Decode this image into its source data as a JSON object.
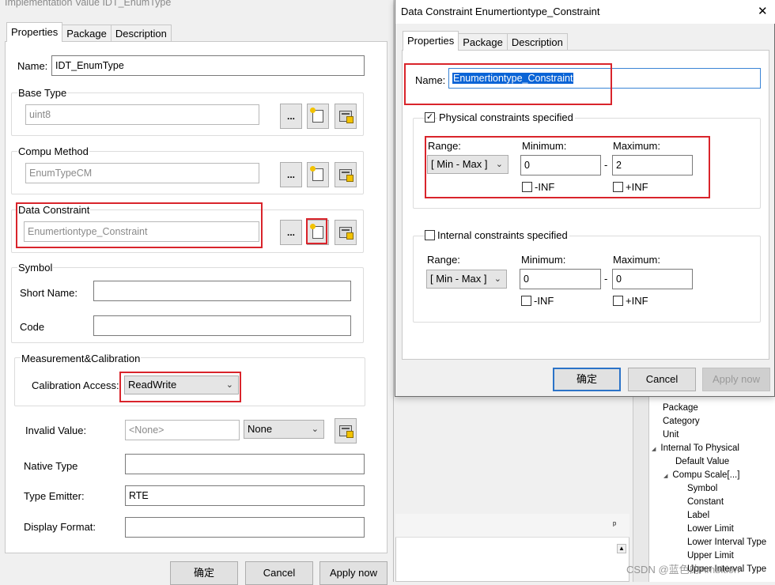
{
  "left_dialog": {
    "title": "Implementation Value IDT_EnumType",
    "tabs": [
      "Properties",
      "Package",
      "Description"
    ],
    "name_label": "Name:",
    "name_value": "IDT_EnumType",
    "base_type": {
      "label": "Base Type",
      "value": "uint8"
    },
    "compu_method": {
      "label": "Compu Method",
      "value": "EnumTypeCM"
    },
    "data_constraint": {
      "label": "Data Constraint",
      "value": "Enumertiontype_Constraint"
    },
    "browse_label": "...",
    "symbol": {
      "label": "Symbol",
      "short_name_label": "Short Name:",
      "code_label": "Code"
    },
    "measurement": {
      "label": "Measurement&Calibration",
      "calibration_access_label": "Calibration Access:",
      "calibration_access_value": "ReadWrite"
    },
    "invalid_value": {
      "label": "Invalid Value:",
      "placeholder": "<None>",
      "select_value": "None"
    },
    "native_type_label": "Native Type",
    "type_emitter": {
      "label": "Type Emitter:",
      "value": "RTE"
    },
    "display_format_label": "Display Format:",
    "buttons": {
      "ok": "确定",
      "cancel": "Cancel",
      "apply": "Apply now"
    }
  },
  "right_dialog": {
    "title": "Data Constraint Enumertiontype_Constraint",
    "close_glyph": "✕",
    "tabs": [
      "Properties",
      "Package",
      "Description"
    ],
    "name_label": "Name:",
    "name_value": "Enumertiontype_Constraint",
    "physical": {
      "label": "Physical constraints specified",
      "checked": true,
      "range_label": "Range:",
      "range_value": "[ Min - Max ]",
      "minimum_label": "Minimum:",
      "minimum_value": "0",
      "maximum_label": "Maximum:",
      "maximum_value": "2",
      "dash": "-",
      "neg_inf_label": "-INF",
      "pos_inf_label": "+INF"
    },
    "internal": {
      "label": "Internal  constraints specified",
      "checked": false,
      "range_label": "Range:",
      "range_value": "[ Min - Max ]",
      "minimum_label": "Minimum:",
      "minimum_value": "0",
      "maximum_label": "Maximum:",
      "maximum_value": "0",
      "dash": "-",
      "neg_inf_label": "-INF",
      "pos_inf_label": "+INF"
    },
    "buttons": {
      "ok": "确定",
      "cancel": "Cancel",
      "apply": "Apply now"
    }
  },
  "tree": {
    "items": [
      {
        "label": "Package",
        "indent": 0
      },
      {
        "label": "Category",
        "indent": 0
      },
      {
        "label": "Unit",
        "indent": 0
      },
      {
        "label": "Internal To Physical",
        "indent": 0,
        "expander": "◢"
      },
      {
        "label": "Default Value",
        "indent": 2
      },
      {
        "label": "Compu Scale[...]",
        "indent": 1,
        "expander": "◢"
      },
      {
        "label": "Symbol",
        "indent": 3
      },
      {
        "label": "Constant",
        "indent": 3
      },
      {
        "label": "Label",
        "indent": 3
      },
      {
        "label": "Lower Limit",
        "indent": 3
      },
      {
        "label": "Lower Interval Type",
        "indent": 3
      },
      {
        "label": "Upper Limit",
        "indent": 3
      },
      {
        "label": "Upper Interval Type",
        "indent": 3
      }
    ]
  },
  "bottom_panel": {
    "pin_glyph": "ᵖ"
  },
  "watermark": "CSDN @蓝色的Ambition"
}
